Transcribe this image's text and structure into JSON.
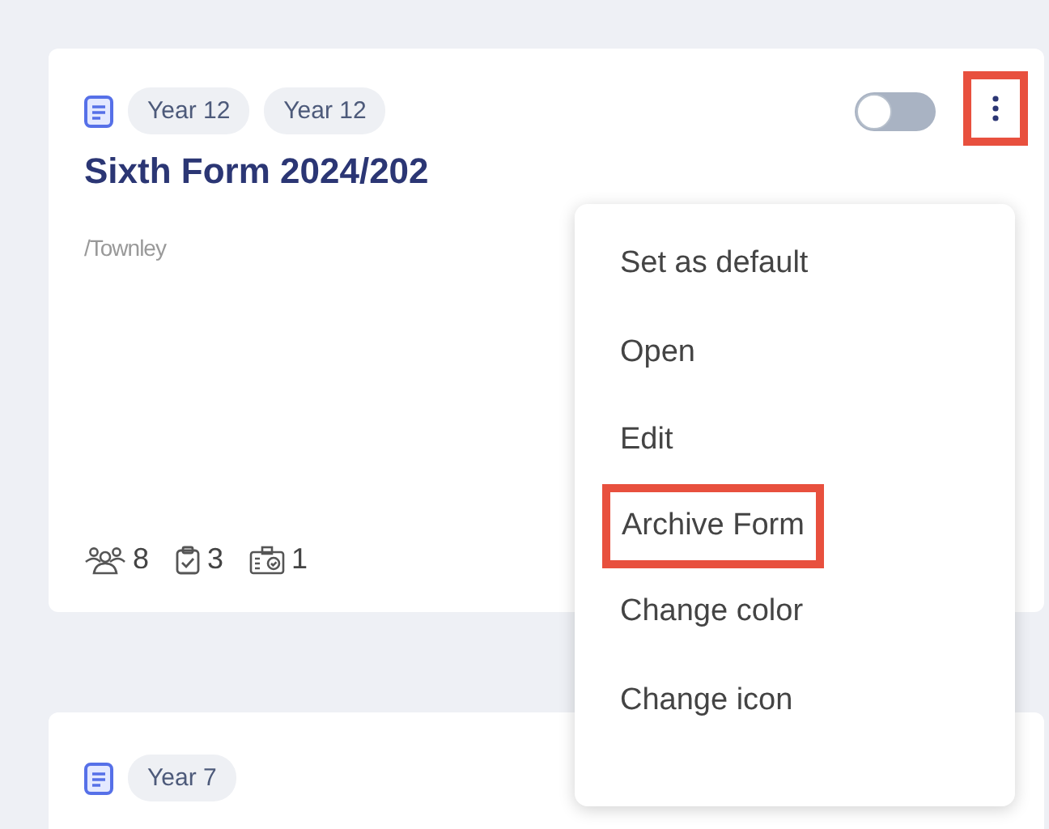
{
  "cards": [
    {
      "tags": [
        "Year 12",
        "Year 12"
      ],
      "title": "Sixth Form 2024/202",
      "subtitle": "/Townley",
      "toggle": {
        "on": false
      },
      "menu_button": {
        "highlighted": true
      },
      "stats": [
        {
          "kind": "people",
          "value": "8"
        },
        {
          "kind": "tasks",
          "value": "3"
        },
        {
          "kind": "badge",
          "value": "1"
        }
      ]
    },
    {
      "tags": [
        "Year 7"
      ]
    }
  ],
  "menu": {
    "items": [
      {
        "label": "Set as default",
        "highlighted": false
      },
      {
        "label": "Open",
        "highlighted": false
      },
      {
        "label": "Edit",
        "highlighted": false
      },
      {
        "label": "Archive Form",
        "highlighted": true
      },
      {
        "label": "Change color",
        "highlighted": false
      },
      {
        "label": "Change icon",
        "highlighted": false
      }
    ]
  }
}
